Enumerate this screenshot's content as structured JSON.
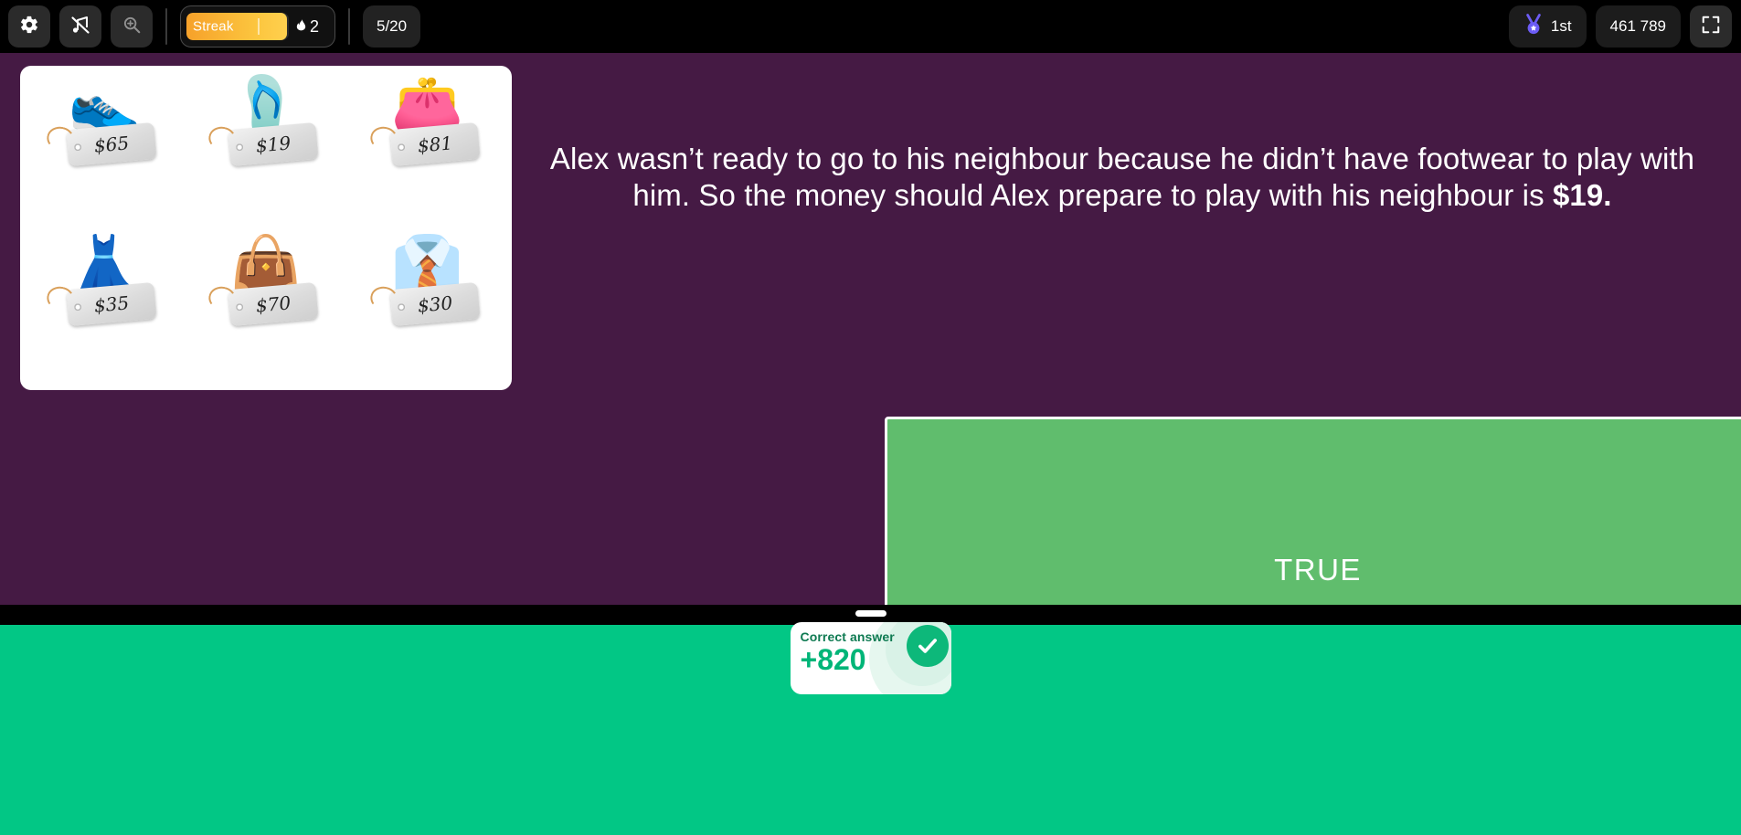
{
  "toolbar": {
    "settings_icon": "gear-icon",
    "sound_icon": "music-muted-icon",
    "zoom_icon": "zoom-in-icon",
    "streak_label": "Streak",
    "streak_count": "2",
    "flame_icon": "flame-icon",
    "question_progress": "5/20",
    "rank_icon": "medal-icon",
    "rank_label": "1st",
    "score": "461 789",
    "fullscreen_icon": "fullscreen-icon"
  },
  "media": {
    "items": [
      {
        "emoji": "👟",
        "name": "sneakers",
        "price": "$65"
      },
      {
        "emoji": "🩴",
        "name": "sandal",
        "price": "$19"
      },
      {
        "emoji": "👛",
        "name": "wallet",
        "price": "$81"
      },
      {
        "emoji": "👗",
        "name": "dress",
        "price": "$35"
      },
      {
        "emoji": "👜",
        "name": "handbag",
        "price": "$70"
      },
      {
        "emoji": "👔",
        "name": "shirt",
        "price": "$30"
      }
    ]
  },
  "question": {
    "text_before": "Alex wasn’t ready to go to his neighbour because he didn’t have footwear to play with him. So the money should Alex prepare to play with his neighbour is ",
    "text_bold": "$19."
  },
  "answers": [
    {
      "label": "TRUE",
      "color": "#60bd6d",
      "selected": true
    }
  ],
  "result": {
    "title": "Correct answer",
    "points": "+820",
    "check_icon": "check-icon"
  },
  "colors": {
    "stage_bg": "#451a44",
    "result_bg": "#02c785",
    "answer_green": "#60bd6d",
    "streak_orange": "#fcc63f",
    "topbar_bg": "#000000"
  }
}
